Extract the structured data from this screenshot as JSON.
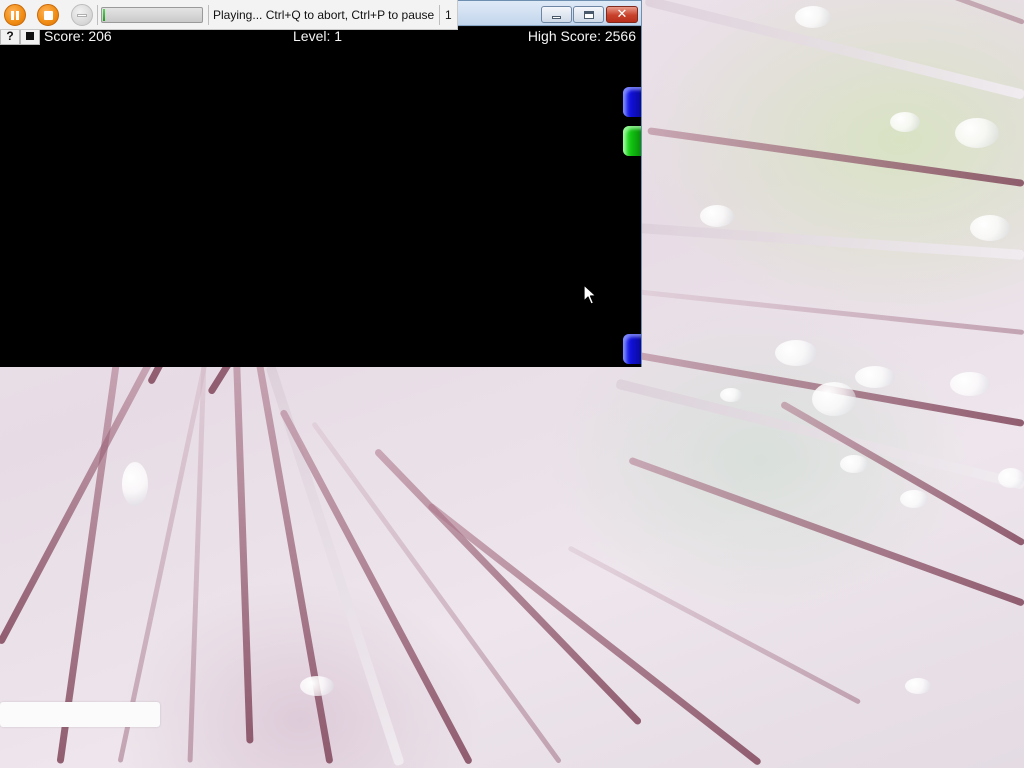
{
  "recorder": {
    "pause_icon": "pause-icon",
    "stop_icon": "stop-icon",
    "disabled_icon": "minus-icon",
    "progress_fraction": 0.02,
    "status_text": "Playing... Ctrl+Q to abort, Ctrl+P to pause",
    "counter": "1",
    "accent_color": "#f08c12",
    "progress_color": "#1f9e1f"
  },
  "window": {
    "minimize_icon": "minimize-icon",
    "maximize_icon": "maximize-icon",
    "close_glyph": "✕"
  },
  "game": {
    "help_label": "?",
    "stop_icon": "stop-square-icon",
    "score": "Score: 206",
    "level": "Level: 1",
    "high_score": "High Score: 2566",
    "blocks": [
      {
        "color": "blue",
        "hex": "#1010d8"
      },
      {
        "color": "green",
        "hex": "#11c411"
      },
      {
        "color": "blue",
        "hex": "#1010d8"
      }
    ]
  },
  "desktop": {
    "wallpaper": "macro photo of pink plant stems with water droplets"
  }
}
